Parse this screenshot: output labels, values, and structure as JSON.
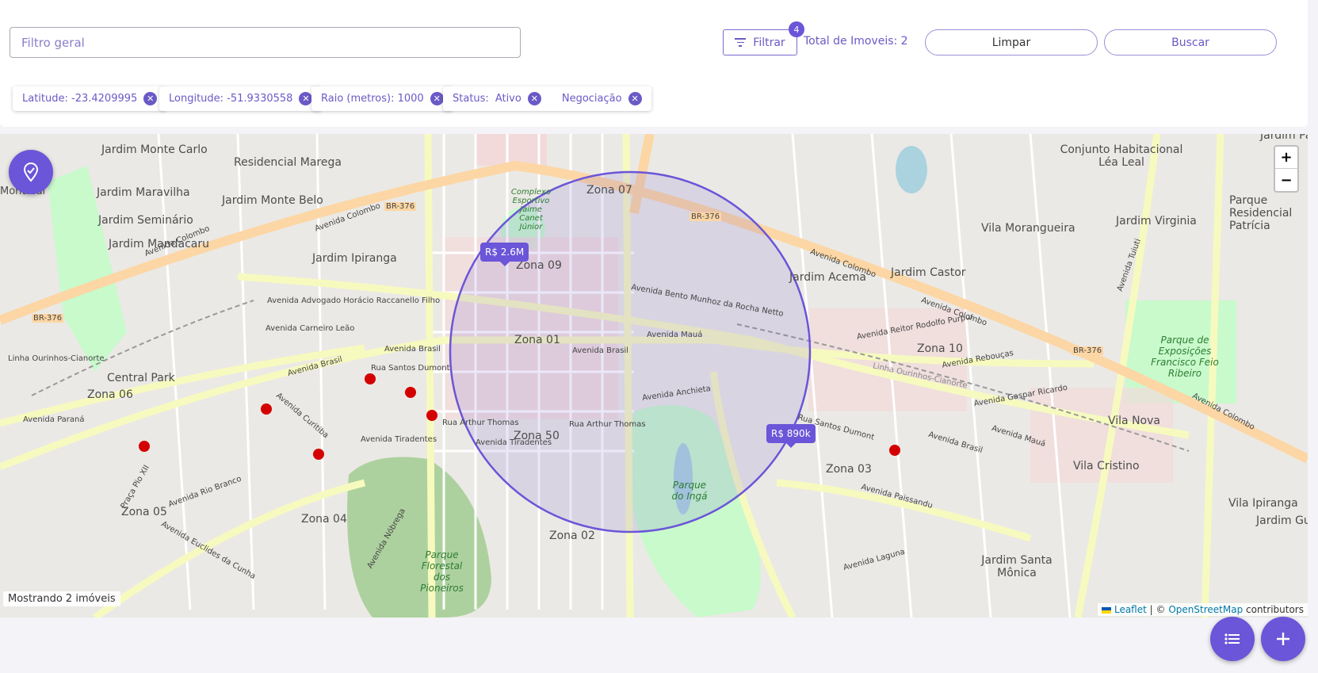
{
  "search": {
    "placeholder": "Filtro geral"
  },
  "filter": {
    "label": "Filtrar",
    "badge_count": "4",
    "total_label": "Total de Imoveis: 2"
  },
  "actions": {
    "clear_label": "Limpar",
    "search_label": "Buscar"
  },
  "chips": {
    "latitude": "Latitude: -23.4209995",
    "longitude": "Longitude: -51.9330558",
    "radius": "Raio (metros): 1000",
    "status_label": "Status:",
    "status_values": [
      "Ativo",
      "Negociação"
    ]
  },
  "map": {
    "markers": [
      {
        "label": "R$ 2.6M"
      },
      {
        "label": "R$ 890k"
      }
    ],
    "labels": {
      "jardim_monte_carlo": "Jardim Monte Carlo",
      "residencial_marega": "Residencial Marega",
      "montreal": "Montreal",
      "jardim_maravilha": "Jardim Maravilha",
      "jardim_monte_belo": "Jardim Monte Belo",
      "jardim_seminario": "Jardim Seminário",
      "jardim_mandacaru": "Jardim Mandacaru",
      "jardim_ipiranga": "Jardim Ipiranga",
      "complexo": "Complexo Esportivo Jaime Canet Júnior",
      "zona_07": "Zona 07",
      "zona_09": "Zona 09",
      "zona_01": "Zona 01",
      "zona_50": "Zona 50",
      "zona_06": "Zona 06",
      "zona_05": "Zona 05",
      "zona_04": "Zona 04",
      "zona_02": "Zona 02",
      "zona_03": "Zona 03",
      "zona_10": "Zona 10",
      "central_park": "Central Park",
      "jardim_acema": "Jardim Acema",
      "jardim_castor": "Jardim Castor",
      "vila_morangueira": "Vila Morangueira",
      "conjunto": "Conjunto Habitacional Léa Leal",
      "jardim_virginia": "Jardim Virginia",
      "parque_residencial": "Parque Residencial Patrícia",
      "parque_exposicoes": "Parque de Exposições Francisco Feio Ribeiro",
      "vila_nova": "Vila Nova",
      "vila_cristino": "Vila Cristino",
      "vila_ipiranga": "Vila Ipiranga",
      "jardim_guar": "Jardim Guar",
      "jardim_santa_monica": "Jardim Santa Mônica",
      "parque_inga": "Parque do Ingá",
      "parque_florestal": "Parque Florestal dos Pioneiros",
      "jardim_pa": "Jardim Pa",
      "av_colombo": "Avenida Colombo",
      "av_brasil": "Avenida Brasil",
      "av_tiradentes": "Avenida Tiradentes",
      "av_parana": "Avenida Paraná",
      "av_bento": "Avenida Bento Munhoz da Rocha Netto",
      "av_maua": "Avenida Mauá",
      "av_reitor": "Avenida Reitor Rodolfo Purpur",
      "av_reboucas": "Avenida Rebouças",
      "av_laguna": "Avenida Laguna",
      "av_paissandu": "Avenida Paissandu",
      "av_carneiro": "Avenida Carneiro Leão",
      "av_advogado": "Avenida Advogado Horácio Raccanello Filho",
      "av_nobrega": "Avenida Nóbrega",
      "av_curitiba": "Avenida Curitiba",
      "av_rio_branco": "Avenida Rio Branco",
      "av_euclides": "Avenida Euclides da Cunha",
      "av_anchieta": "Avenida Anchieta",
      "av_gaspar": "Avenida Gaspar Ricardo",
      "av_tuiuti": "Avenida Tuiuti",
      "praca_pio": "Praça Pio XII",
      "br376": "BR-376",
      "linha": "Linha Ourinhos-Cianorte",
      "rua_santos_dumont": "Rua Santos Dumont",
      "rua_arthur_thomas": "Rua Arthur Thomas"
    },
    "showing": "Mostrando 2 imóveis",
    "attribution": {
      "leaflet": "Leaflet",
      "separator": "| ©",
      "osm": "OpenStreetMap",
      "contributors": "contributors"
    },
    "zoom_in": "+",
    "zoom_out": "−"
  },
  "colors": {
    "accent": "#6b55d8",
    "circle": "#6b55d8",
    "major_road": "#f7fabf",
    "trunk_road": "#fcd6a4",
    "park": "#c8facc"
  },
  "icons": {
    "locate": "map-pin-icon",
    "list": "list-icon",
    "add": "plus-icon",
    "filter": "filter-icon",
    "close": "close-icon"
  }
}
